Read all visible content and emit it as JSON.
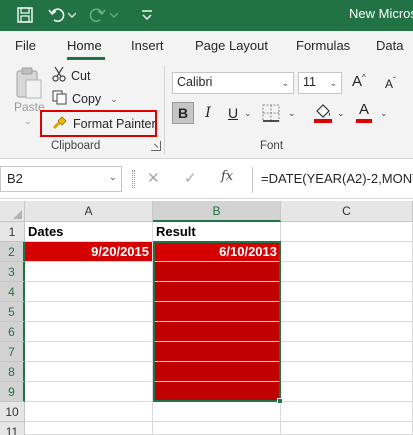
{
  "titlebar": {
    "title": "New Micros",
    "icons": [
      "save-icon",
      "undo-icon",
      "undo-dropdown-icon",
      "redo-icon",
      "redo-dropdown-icon",
      "customize-icon"
    ],
    "color": "#217346"
  },
  "tabs": [
    "File",
    "Home",
    "Insert",
    "Page Layout",
    "Formulas",
    "Data"
  ],
  "active_tab": "Home",
  "clipboard": {
    "paste_label": "Paste",
    "cut_label": "Cut",
    "copy_label": "Copy",
    "format_painter_label": "Format Painter",
    "group_label": "Clipboard"
  },
  "font": {
    "font_name": "Calibri",
    "font_size": "11",
    "group_label": "Font",
    "bold": "B",
    "italic": "I",
    "underline": "U",
    "font_color_glyph": "A",
    "accent_red": "#e00000"
  },
  "formula_bar": {
    "name_box": "B2",
    "fx": "fx",
    "formula": "=DATE(YEAR(A2)-2,MONT"
  },
  "sheet": {
    "columns": [
      "A",
      "B",
      "C"
    ],
    "rows": [
      "1",
      "2",
      "3",
      "4",
      "5",
      "6",
      "7",
      "8",
      "9",
      "10",
      "11"
    ],
    "a1": "Dates",
    "b1": "Result",
    "a2": "9/20/2015",
    "b2": "6/10/2013",
    "highlight_red": "#d50000",
    "fill_dark_red": "#c00000"
  }
}
